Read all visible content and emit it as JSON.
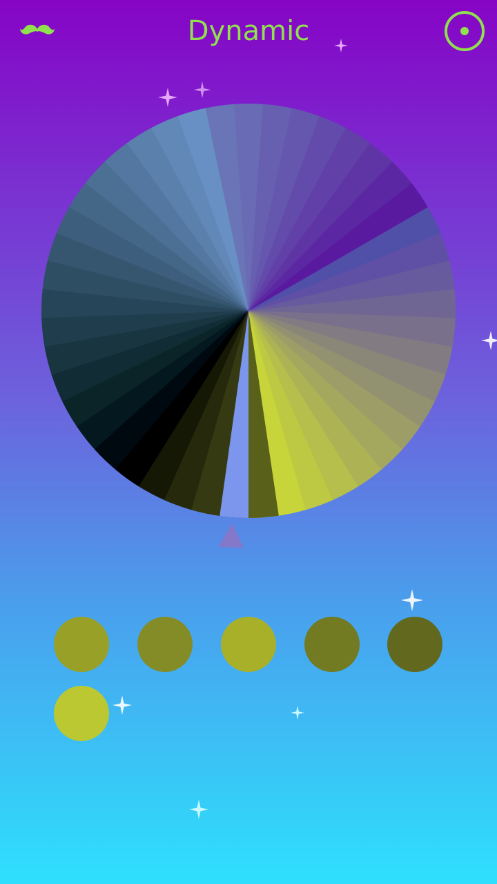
{
  "header": {
    "title": "Dynamic",
    "title_color": "#8fe14d",
    "left_icon": "mustache-icon",
    "right_icon": "radio-target-icon"
  },
  "wheel": {
    "selected_color": "#d0de32",
    "segment_colors": [
      "#d0de32",
      "#c7d43a",
      "#bec943",
      "#b6be4c",
      "#adb355",
      "#a4a85e",
      "#9c9d67",
      "#939270",
      "#8a8779",
      "#827c82",
      "#79718b",
      "#706694",
      "#685b9d",
      "#5f50a6",
      "#5050a8",
      "#5a1aa0",
      "#5c27a2",
      "#5f34a5",
      "#6140a8",
      "#634bab",
      "#6556ae",
      "#6760b1",
      "#696bb4",
      "#6975b6",
      "#6990c4",
      "#6288b8",
      "#5b80ac",
      "#5377a0",
      "#4c6f94",
      "#446788",
      "#3d5e7c",
      "#365670",
      "#2e4e64",
      "#274558",
      "#1f3d4c",
      "#183540",
      "#112c34",
      "#0a2428",
      "#041820",
      "#000810",
      "#000000",
      "#161806",
      "#26290c",
      "#363a12",
      "#474c18",
      "#58601a"
    ]
  },
  "palette": {
    "swatches": [
      {
        "name": "swatch-1",
        "color": "#99a028"
      },
      {
        "name": "swatch-2",
        "color": "#848c28"
      },
      {
        "name": "swatch-3",
        "color": "#a8b02a"
      },
      {
        "name": "swatch-4",
        "color": "#727a22"
      },
      {
        "name": "swatch-5",
        "color": "#62681e"
      },
      {
        "name": "swatch-6",
        "color": "#bcc832"
      }
    ]
  }
}
